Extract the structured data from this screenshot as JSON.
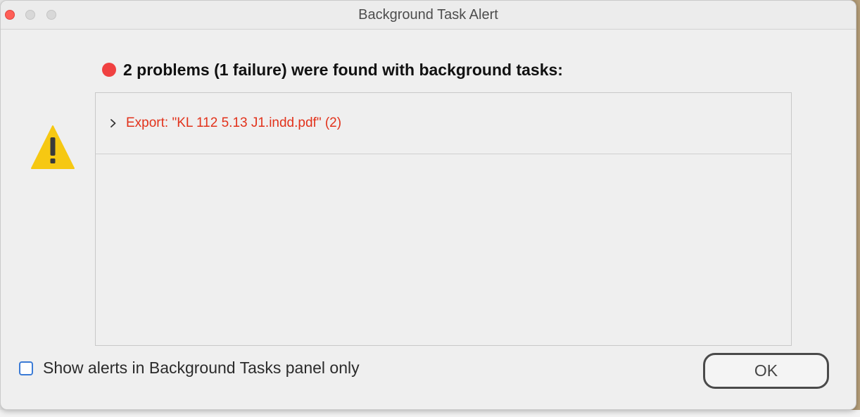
{
  "window": {
    "title": "Background Task Alert"
  },
  "headline": {
    "text": "2 problems (1 failure) were found with background tasks:",
    "status_color": "#f04141"
  },
  "problems": [
    {
      "label": "Export: \"KL 112 5.13 J1.indd.pdf\" (2)",
      "expanded": false,
      "color": "#e2321b"
    }
  ],
  "options": {
    "checkbox_label": "Show alerts in Background Tasks panel only",
    "checkbox_checked": false
  },
  "buttons": {
    "ok_label": "OK"
  },
  "icons": {
    "alert": "warning-triangle-icon",
    "expand": "chevron-right-icon"
  }
}
